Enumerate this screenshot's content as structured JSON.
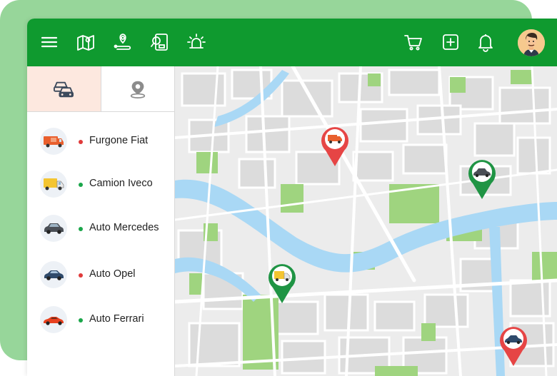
{
  "topbar": {
    "menu_icon": "menu-icon",
    "map_icon": "map-icon",
    "route_icon": "route-pin-icon",
    "search_doc_icon": "document-search-icon",
    "alarm_icon": "alarm-light-icon",
    "cart_icon": "cart-icon",
    "add_icon": "plus-square-icon",
    "bell_icon": "bell-icon",
    "avatar_icon": "user-avatar"
  },
  "sidebar": {
    "tabs": [
      {
        "icon": "vehicles-icon",
        "active": true
      },
      {
        "icon": "location-pin-icon",
        "active": false
      }
    ],
    "vehicles": [
      {
        "label": "Furgone Fiat",
        "status_color": "#e03a3a",
        "icon": "van-icon"
      },
      {
        "label": "Camion Iveco",
        "status_color": "#1aa64a",
        "icon": "truck-icon"
      },
      {
        "label": "Auto Mercedes",
        "status_color": "#1aa64a",
        "icon": "car-icon"
      },
      {
        "label": "Auto Opel",
        "status_color": "#e03a3a",
        "icon": "car-icon"
      },
      {
        "label": "Auto Ferrari",
        "status_color": "#1aa64a",
        "icon": "sports-car-icon"
      }
    ]
  },
  "map": {
    "markers": [
      {
        "vehicle": "Furgone Fiat",
        "color": "#e64545"
      },
      {
        "vehicle": "Auto Mercedes",
        "color": "#1f9444"
      },
      {
        "vehicle": "Camion Iveco",
        "color": "#1f9444"
      },
      {
        "vehicle": "Auto Opel",
        "color": "#e64545"
      }
    ]
  },
  "colors": {
    "brand": "#0f9a2f",
    "backdrop": "#97d69a",
    "river": "#a9d8f5",
    "park": "#9fd47f"
  }
}
